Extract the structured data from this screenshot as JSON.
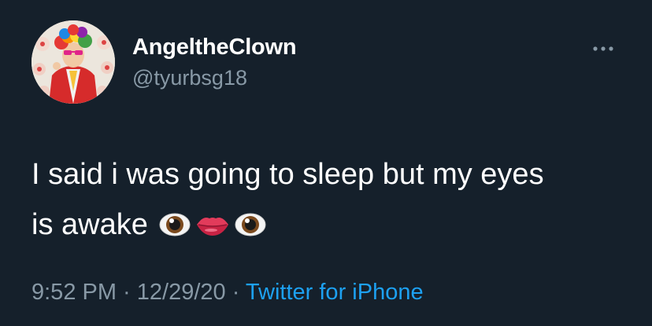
{
  "user": {
    "display_name": "AngeltheClown",
    "handle": "@tyurbsg18"
  },
  "tweet": {
    "text_line1": "I said i was going to sleep but my eyes",
    "text_line2": "is awake",
    "emojis": [
      "eye-emoji",
      "lips-emoji",
      "eye-emoji"
    ]
  },
  "meta": {
    "time": "9:52 PM",
    "separator1": " · ",
    "date": "12/29/20",
    "separator2": " · ",
    "source": "Twitter for iPhone"
  },
  "icons": {
    "more": "more-options-icon"
  },
  "colors": {
    "background": "#15202b",
    "secondary_text": "#8899a6",
    "link": "#1da1f2"
  }
}
